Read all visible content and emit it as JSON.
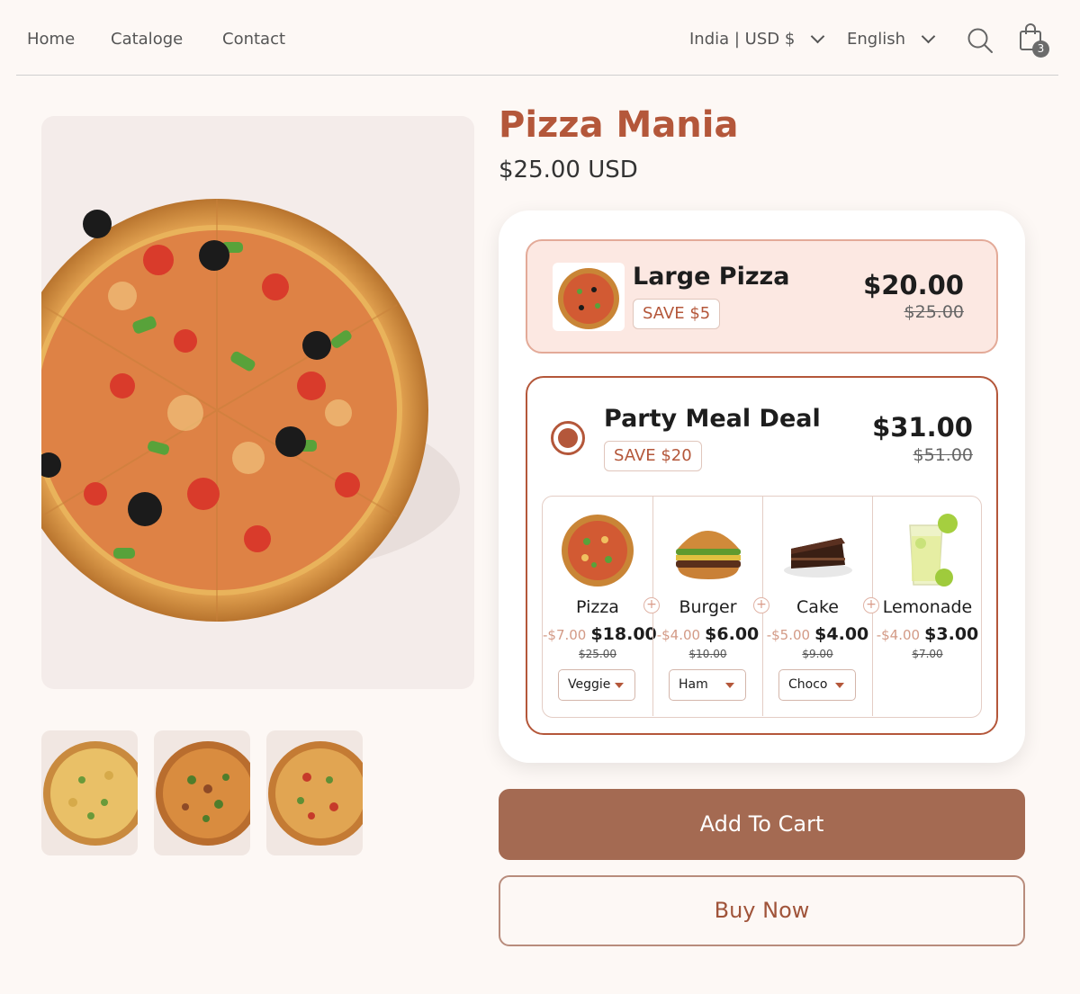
{
  "nav": {
    "links": [
      "Home",
      "Cataloge",
      "Contact"
    ],
    "region": "India | USD $",
    "language": "English",
    "cart_count": "3"
  },
  "product": {
    "title": "Pizza Mania",
    "price": "$25.00 USD"
  },
  "options": {
    "large": {
      "name": "Large Pizza",
      "save": "SAVE $5",
      "price": "$20.00",
      "old_price": "$25.00"
    },
    "party": {
      "name": "Party Meal Deal",
      "save": "SAVE $20",
      "price": "$31.00",
      "old_price": "$51.00",
      "selected": true,
      "items": [
        {
          "name": "Pizza",
          "discount": "-$7.00",
          "price": "$18.00",
          "old": "$25.00",
          "variant": "Veggie"
        },
        {
          "name": "Burger",
          "discount": "-$4.00",
          "price": "$6.00",
          "old": "$10.00",
          "variant": "Ham"
        },
        {
          "name": "Cake",
          "discount": "-$5.00",
          "price": "$4.00",
          "old": "$9.00",
          "variant": "Choco"
        },
        {
          "name": "Lemonade",
          "discount": "-$4.00",
          "price": "$3.00",
          "old": "$7.00",
          "variant": ""
        }
      ]
    }
  },
  "buttons": {
    "add_to_cart": "Add To Cart",
    "buy_now": "Buy Now"
  },
  "colors": {
    "accent": "#b4573a",
    "cart_button": "#a46a52",
    "highlight_bg": "#fce8e2",
    "page_bg": "#fdf8f5"
  }
}
